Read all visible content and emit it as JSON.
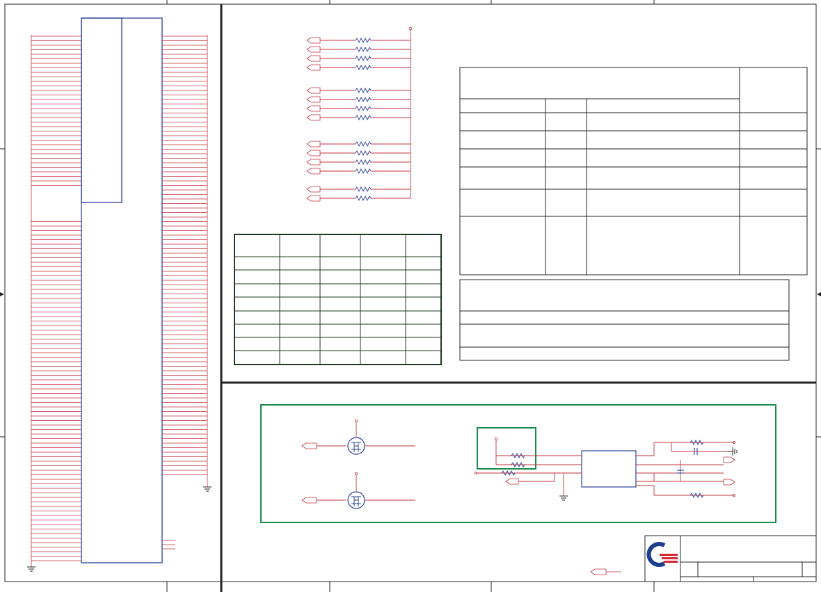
{
  "sheet": {
    "type": "schematic",
    "colors": {
      "wire": "#c0303a",
      "component": "#2b3f9a",
      "frame": "#222222",
      "table_border": "#1e3a1e",
      "group_box": "#1a8a4a",
      "logo_red": "#d7262e",
      "logo_blue": "#1d3d8f"
    },
    "text": []
  },
  "title_block": {
    "logo": "company-logo"
  }
}
